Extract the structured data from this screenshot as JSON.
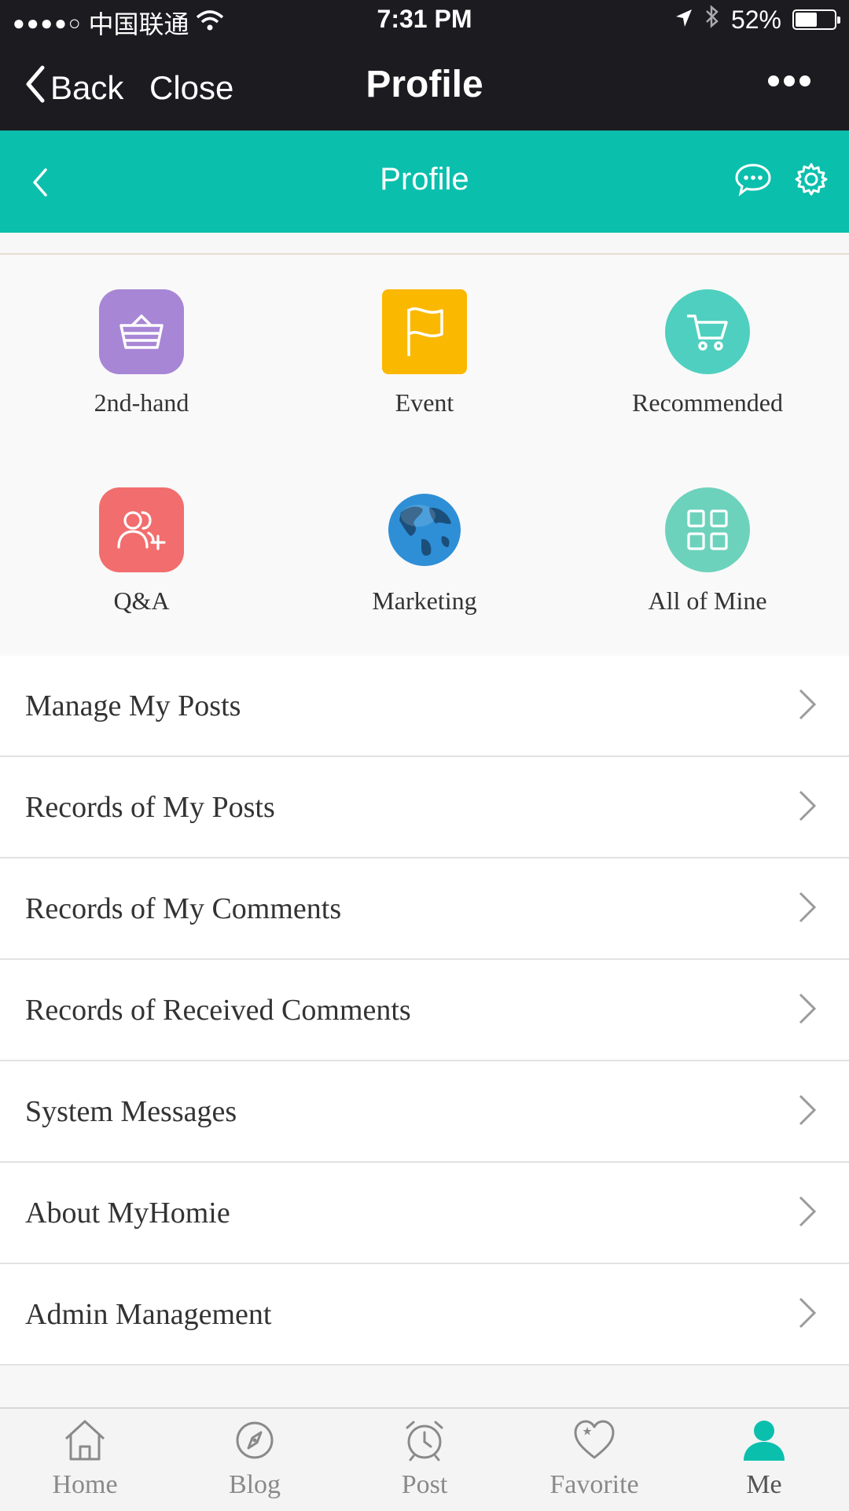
{
  "status_bar": {
    "signal": "●●●●○",
    "carrier": "中国联通",
    "time": "7:31 PM",
    "battery": "52%",
    "battery_level": 0.52
  },
  "nav_bar": {
    "back_label": "Back",
    "close_label": "Close",
    "title": "Profile"
  },
  "app_bar": {
    "title": "Profile",
    "accent": "#0bbfad"
  },
  "grid": {
    "items": [
      {
        "label": "2nd-hand",
        "icon": "basket-icon",
        "color": "#a886d6"
      },
      {
        "label": "Event",
        "icon": "flag-icon",
        "color": "#fbb800"
      },
      {
        "label": "Recommended",
        "icon": "cart-icon",
        "color": "#4fcfbf"
      },
      {
        "label": "Q&A",
        "icon": "add-user-icon",
        "color": "#f26d6d"
      },
      {
        "label": "Marketing",
        "icon": "globe-icon",
        "color": "#2e8fd6"
      },
      {
        "label": "All of Mine",
        "icon": "grid-icon",
        "color": "#6dd2bc"
      }
    ]
  },
  "menu": {
    "items": [
      {
        "label": "Manage My Posts"
      },
      {
        "label": "Records of My Posts"
      },
      {
        "label": "Records of My Comments"
      },
      {
        "label": "Records of Received Comments"
      },
      {
        "label": "System Messages"
      },
      {
        "label": "About MyHomie"
      },
      {
        "label": "Admin Management"
      }
    ]
  },
  "tab_bar": {
    "items": [
      {
        "label": "Home",
        "icon": "home-icon"
      },
      {
        "label": "Blog",
        "icon": "compass-icon"
      },
      {
        "label": "Post",
        "icon": "alarm-clock-icon"
      },
      {
        "label": "Favorite",
        "icon": "heart-icon"
      },
      {
        "label": "Me",
        "icon": "person-icon"
      }
    ],
    "active": "Me"
  }
}
